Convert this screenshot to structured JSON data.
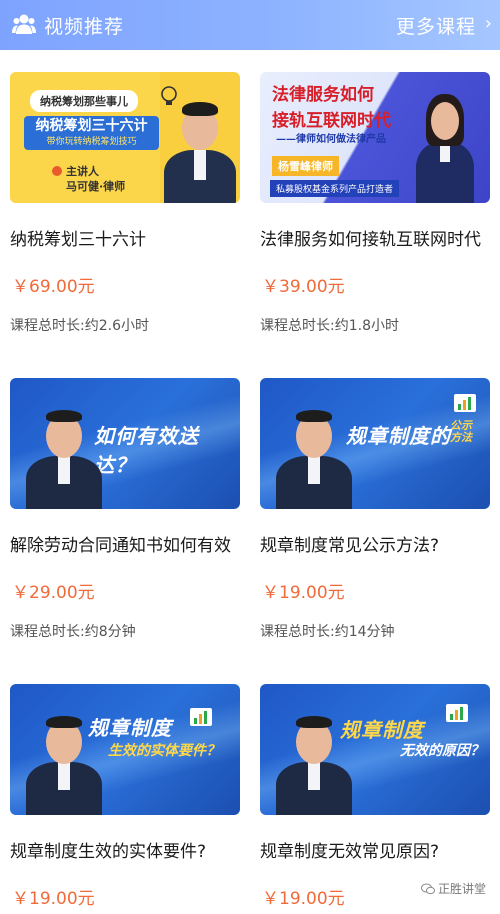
{
  "header": {
    "title": "视频推荐",
    "more": "更多课程",
    "more_chevron": "›"
  },
  "accent_color": "#f06a3a",
  "courses": [
    {
      "title": "纳税筹划三十六计",
      "price": "￥69.00元",
      "duration": "课程总时长:约2.6小时",
      "thumb": {
        "tag": "纳税筹划那些事儿",
        "headline": "纳税筹划三十六计",
        "sub": "带你玩转纳税筹划技巧",
        "speaker_role": "主讲人",
        "speaker_name": "马可健·律师"
      }
    },
    {
      "title": "法律服务如何接轨互联网时代",
      "price": "￥39.00元",
      "duration": "课程总时长:约1.8小时",
      "thumb": {
        "headline_1": "法律服务如何",
        "headline_2": "接轨互联网时代",
        "sub": "——律师如何做法律产品",
        "name": "杨雪峰律师",
        "tag": "私募股权基金系列产品打造者"
      }
    },
    {
      "title": "解除劳动合同通知书如何有效",
      "price": "￥29.00元",
      "duration": "课程总时长:约8分钟",
      "thumb": {
        "headline": "如何有效送达？",
        "headline_2": ""
      }
    },
    {
      "title": "规章制度常见公示方法?",
      "price": "￥19.00元",
      "duration": "课程总时长:约14分钟",
      "thumb": {
        "headline": "规章制度的",
        "headline_2": "公示方法"
      }
    },
    {
      "title": "规章制度生效的实体要件?",
      "price": "￥19.00元",
      "duration": "",
      "thumb": {
        "headline": "规章制度",
        "headline_2": "生效的实体要件？"
      }
    },
    {
      "title": "规章制度无效常见原因?",
      "price": "￥19.00元",
      "duration": "",
      "thumb": {
        "headline": "规章制度",
        "headline_2": "无效的原因？"
      }
    }
  ],
  "watermark": "正胜讲堂",
  "icons": [
    "group-icon",
    "chevron-right-icon",
    "wechat-icon"
  ]
}
